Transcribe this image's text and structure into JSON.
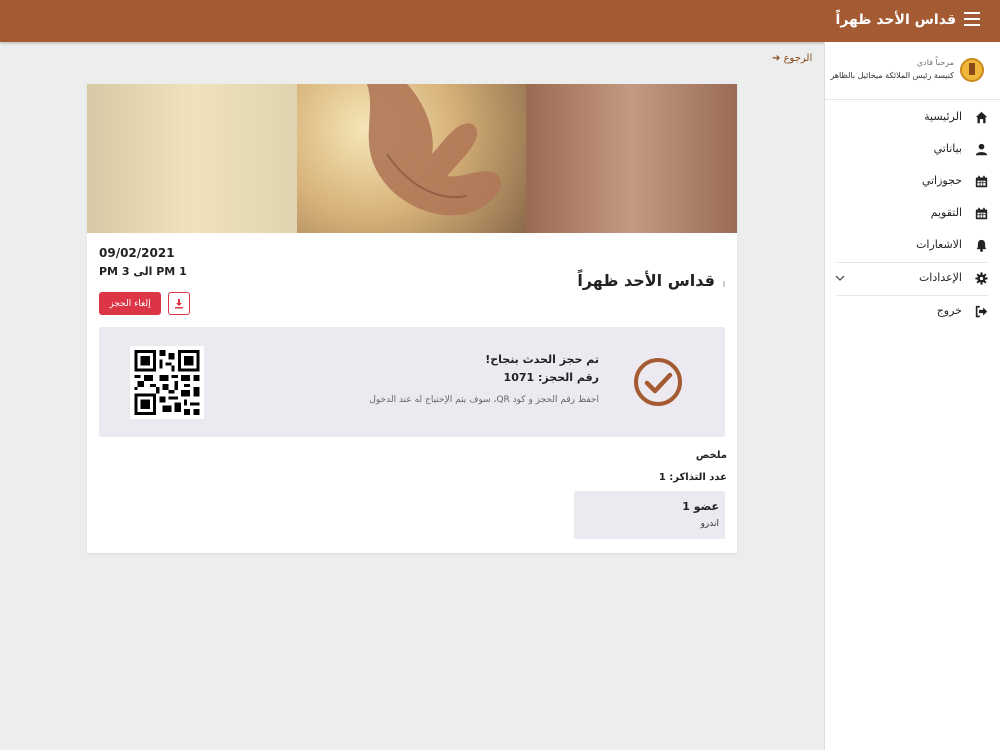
{
  "header": {
    "title": "قداس الأحد ظهراً"
  },
  "user": {
    "greeting": "مرحباً فادي",
    "church": "كنيسة رئيس الملائكة ميخائيل بالظاهر"
  },
  "nav": {
    "home": "الرئيسية",
    "profile": "بياناتي",
    "bookings": "حجوزاتي",
    "calendar": "التقويم",
    "notifications": "الاشعارات",
    "settings": "الإعدادات",
    "logout": "خروج"
  },
  "back_label": "الرجوع",
  "event": {
    "title": "قداس الأحد ظهراً",
    "date": "09/02/2021",
    "time": "1 PM الى 3 PM",
    "cancel_label": "إلغاء الحجز"
  },
  "confirmation": {
    "title": "تم حجز الحدث بنجاح!",
    "booking_number": "رقم الحجز: 1071",
    "note": "احفظ رقم الحجز و كود QR، سوف يتم الإحتياج له عند الدخول"
  },
  "summary": {
    "heading": "ملخص",
    "tickets": "عدد التذاكر: 1",
    "member_name": "عضو 1",
    "member_sub": "اندرو"
  },
  "colors": {
    "brand": "#a45a32",
    "danger": "#dc3545",
    "panel": "#eceaf0"
  }
}
